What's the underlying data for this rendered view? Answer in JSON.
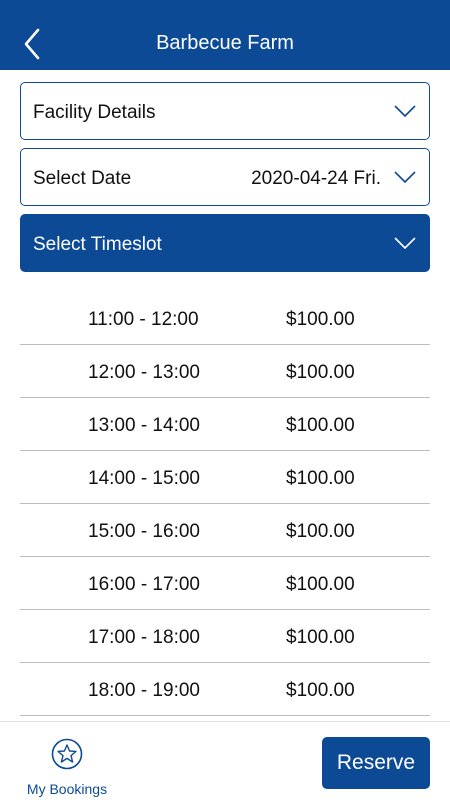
{
  "header": {
    "title": "Barbecue Farm",
    "back_icon": "chevron-left-icon"
  },
  "panels": {
    "facility": {
      "label": "Facility Details"
    },
    "date": {
      "label": "Select Date",
      "value": "2020-04-24 Fri."
    },
    "timeslot": {
      "label": "Select Timeslot"
    }
  },
  "slots": [
    {
      "time": "11:00 - 12:00",
      "price": "$100.00"
    },
    {
      "time": "12:00 - 13:00",
      "price": "$100.00"
    },
    {
      "time": "13:00 - 14:00",
      "price": "$100.00"
    },
    {
      "time": "14:00 - 15:00",
      "price": "$100.00"
    },
    {
      "time": "15:00 - 16:00",
      "price": "$100.00"
    },
    {
      "time": "16:00 - 17:00",
      "price": "$100.00"
    },
    {
      "time": "17:00 - 18:00",
      "price": "$100.00"
    },
    {
      "time": "18:00 - 19:00",
      "price": "$100.00"
    }
  ],
  "footer": {
    "bookings_label": "My Bookings",
    "reserve_label": "Reserve"
  },
  "colors": {
    "primary": "#0d4a96",
    "divider": "#bdbdbd"
  }
}
